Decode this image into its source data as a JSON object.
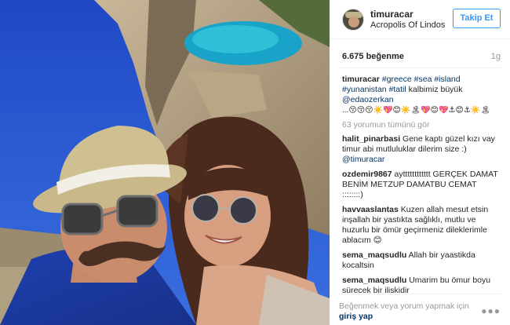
{
  "header": {
    "username": "timuracar",
    "location": "Acropolis Of Lindos",
    "follow_label": "Takip Et"
  },
  "stats": {
    "likes": "6.675 beğenme",
    "age": "1g"
  },
  "caption": {
    "username": "timuracar",
    "hashtags_line1": "#greece #sea #island",
    "hashtags_line2": "#yunanistan #tatil",
    "text": "kalbimiz büyük",
    "mention": "@edaozerkan",
    "emojis": "...😚😚😚☀️💖😊☀️🏝💖😊💖⚓😊⚓☀️🏝"
  },
  "view_all": "63 yorumun tümünü gör",
  "comments": [
    {
      "username": "halit_pinarbasi",
      "text": "Gene kaptı güzel kızı vay timur abi mutluluklar dilerim size :)",
      "mention": "@timuracar"
    },
    {
      "username": "ozdemir9867",
      "text": "aytttttttttttt GERÇEK DAMAT BENİM METZUP DAMATBU CEMAT ::::::::)",
      "mention": ""
    },
    {
      "username": "havvaaslantas",
      "text": "Kuzen allah mesut etsin inşallah bir yastıkta sağlıklı, mutlu ve huzurlu bir ömür geçirmeniz dileklerimle ablacım 😊",
      "mention": ""
    },
    {
      "username": "sema_maqsudlu",
      "text": "Allah bir yaastikda kocaltsin",
      "mention": ""
    },
    {
      "username": "sema_maqsudlu",
      "text": "Umarim bu ömur boyu sürecek bir iliskidir",
      "mention": ""
    }
  ],
  "footer": {
    "text": "Beğenmek veya yorum yapmak için",
    "login_label": "giriş yap",
    "more_icon": "more-options-icon"
  }
}
